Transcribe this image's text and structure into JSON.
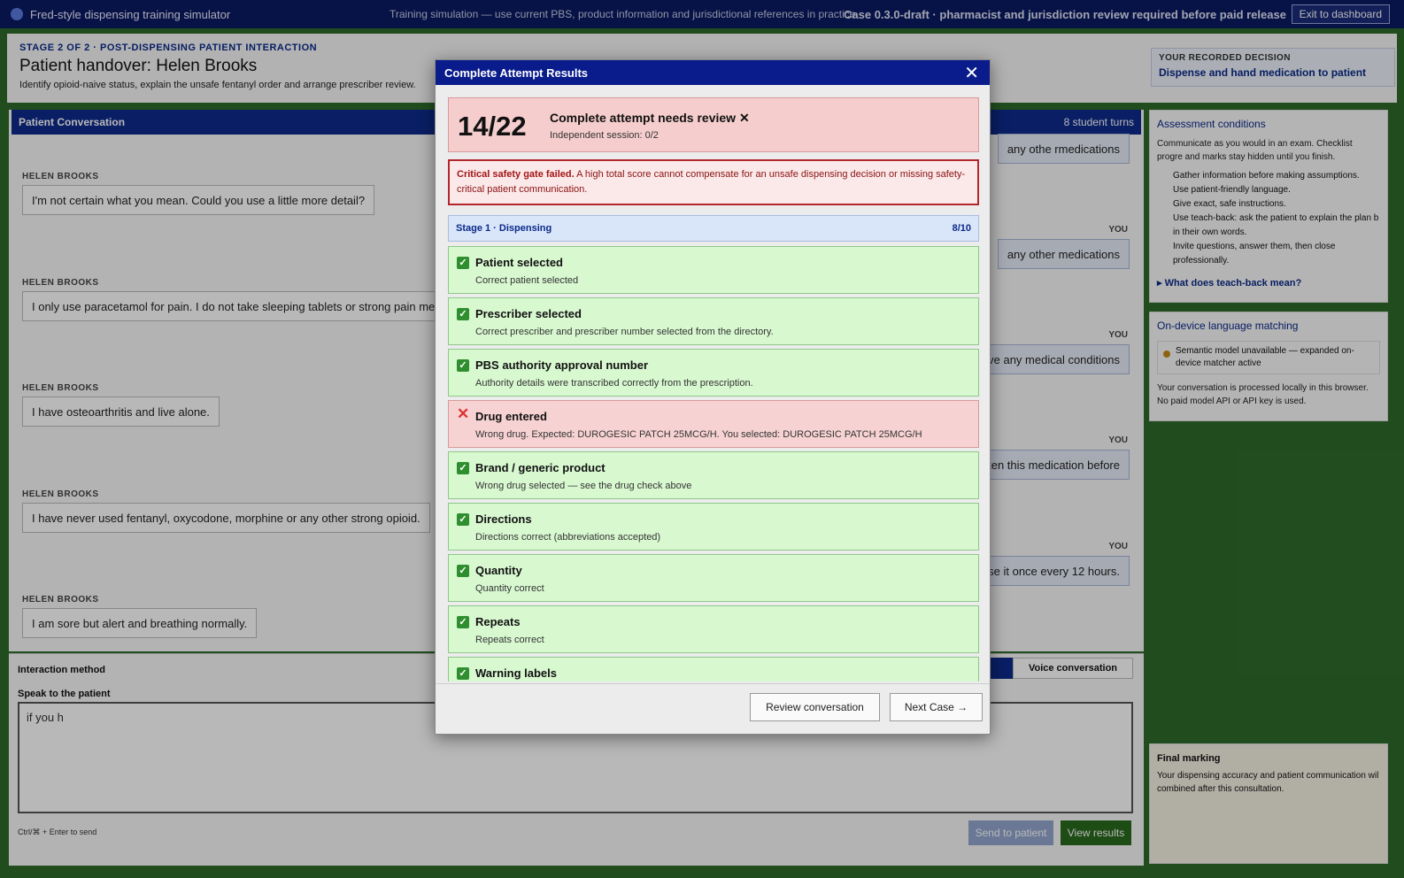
{
  "topbar": {
    "app_title": "Fred-style dispensing training simulator",
    "notice": "Training simulation — use current PBS, product information and jurisdictional references in practice.",
    "case_info": "Case 0.3.0-draft · pharmacist and jurisdiction review required before paid release",
    "exit_label": "Exit to dashboard"
  },
  "stage": {
    "label": "STAGE 2 OF 2 · POST-DISPENSING PATIENT INTERACTION",
    "title": "Patient handover: Helen Brooks",
    "subtitle": "Identify opioid-naive status, explain the unsafe fentanyl order and arrange prescriber review.",
    "decision_label": "YOUR RECORDED DECISION",
    "decision_value": "Dispense and hand medication to patient"
  },
  "conversation": {
    "header": "Patient Conversation",
    "turns": "8 student turns",
    "patient_name_label": "HELEN BROOKS",
    "you_label": "YOU",
    "patient_messages": [
      "I'm not certain what you mean. Could you use a little more detail?",
      "I only use paracetamol for pain. I do not take sleeping tablets or strong pain medic",
      "I have osteoarthritis and live alone.",
      "I have never used fentanyl, oxycodone, morphine or any other strong opioid.",
      "I am sore but alert and breathing normally."
    ],
    "student_messages": [
      "any othe rmedications",
      "any other medications",
      "have any medical conditions",
      "taken this medication before",
      ", use it once every 12 hours."
    ]
  },
  "input": {
    "method_label": "Interaction method",
    "voice_tab": "Voice conversation",
    "speak_label": "Speak to the patient",
    "speak_value": "if you h",
    "hint": "Ctrl/⌘ + Enter to send",
    "send_label": "Send to patient",
    "results_label": "View results"
  },
  "sidebar": {
    "conditions_title": "Assessment conditions",
    "conditions_text": "Communicate as you would in an exam. Checklist progre and marks stay hidden until you finish.",
    "conditions_items": [
      "Gather information before making assumptions.",
      "Use patient-friendly language.",
      "Give exact, safe instructions.",
      "Use teach-back: ask the patient to explain the plan b in their own words.",
      "Invite questions, answer them, then close professionally."
    ],
    "teachback_link": "What does teach-back mean?",
    "lang_title": "On-device language matching",
    "lang_status": "Semantic model unavailable — expanded on-device matcher active",
    "lang_text": "Your conversation is processed locally in this browser. No paid model API or API key is used.",
    "final_title": "Final marking",
    "final_text": "Your dispensing accuracy and patient communication wil combined after this consultation."
  },
  "modal": {
    "title": "Complete Attempt Results",
    "score": "14/22",
    "result_title": "Complete attempt needs review ✕",
    "session": "Independent session: 0/2",
    "gate_bold": "Critical safety gate failed.",
    "gate_text": " A high total score cannot compensate for an unsafe dispensing decision or missing safety-critical patient communication.",
    "stage_label": "Stage 1 · Dispensing",
    "stage_score": "8/10",
    "checks": [
      {
        "title": "Patient selected",
        "detail": "Correct patient selected",
        "pass": true
      },
      {
        "title": "Prescriber selected",
        "detail": "Correct prescriber and prescriber number selected from the directory.",
        "pass": true
      },
      {
        "title": "PBS authority approval number",
        "detail": "Authority details were transcribed correctly from the prescription.",
        "pass": true
      },
      {
        "title": "Drug entered",
        "detail": "Wrong drug. Expected: DUROGESIC PATCH 25MCG/H. You selected: DUROGESIC PATCH 25MCG/H",
        "pass": false
      },
      {
        "title": "Brand / generic product",
        "detail": "Wrong drug selected — see the drug check above",
        "pass": true
      },
      {
        "title": "Directions",
        "detail": "Directions correct (abbreviations accepted)",
        "pass": true
      },
      {
        "title": "Quantity",
        "detail": "Quantity correct",
        "pass": true
      },
      {
        "title": "Repeats",
        "detail": "Repeats correct",
        "pass": true
      },
      {
        "title": "Warning labels",
        "detail": "",
        "pass": true
      }
    ],
    "review_label": "Review conversation",
    "next_label": "Next Case →"
  }
}
